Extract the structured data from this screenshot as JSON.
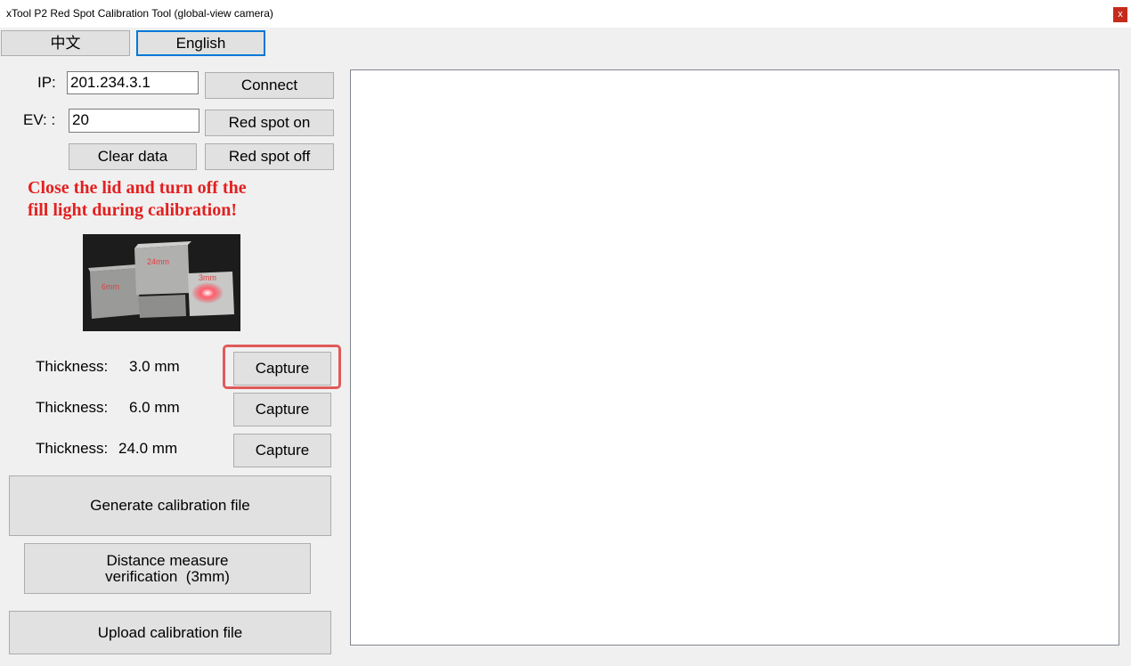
{
  "window": {
    "title": "xTool P2 Red Spot Calibration Tool (global-view camera)",
    "close_glyph": "x"
  },
  "language": {
    "chinese": "中文",
    "english": "English"
  },
  "connection": {
    "ip_label": "IP:",
    "ip_value": "201.234.3.1",
    "connect": "Connect",
    "ev_label": "EV: :",
    "ev_value": "20",
    "red_spot_on": "Red spot on",
    "clear_data": "Clear data",
    "red_spot_off": "Red spot off"
  },
  "warning": {
    "line1": "Close the lid and turn off the",
    "line2": "fill light during calibration!",
    "color": "#e32020"
  },
  "photo": {
    "labels": [
      "6mm",
      "24mm",
      "3mm"
    ]
  },
  "thickness": [
    {
      "label": "Thickness:",
      "value": "3.0 mm",
      "button": "Capture"
    },
    {
      "label": "Thickness:",
      "value": "6.0 mm",
      "button": "Capture"
    },
    {
      "label": "Thickness:",
      "value": "24.0 mm",
      "button": "Capture"
    }
  ],
  "actions": {
    "generate": "Generate calibration file",
    "distance_line1": "Distance measure",
    "distance_line2": "verification  (3mm)",
    "upload": "Upload calibration file"
  },
  "colors": {
    "highlight": "#e05a5a",
    "selected_border": "#0078d7"
  }
}
